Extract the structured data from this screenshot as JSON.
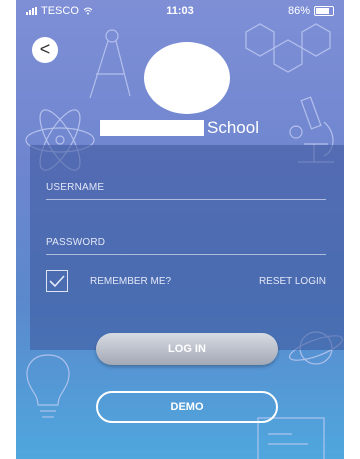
{
  "status_bar": {
    "carrier": "TESCO",
    "time": "11:03",
    "battery": "86%"
  },
  "header": {
    "back_symbol": "<",
    "school_name": "School"
  },
  "form": {
    "username_label": "USERNAME",
    "password_label": "PASSWORD",
    "remember_label": "REMEMBER ME?",
    "remember_checked": true,
    "reset_label": "RESET LOGIN"
  },
  "buttons": {
    "login_label": "LOG IN",
    "demo_label": "DEMO"
  },
  "colors": {
    "background_top": "#7e8fd6",
    "background_bottom": "#4fa7de",
    "panel": "#3c559b",
    "login_button": "#b9bdc8",
    "text": "#ffffff"
  },
  "icons": [
    "wifi-icon",
    "battery-icon",
    "back-arrow-icon",
    "compass-icon",
    "molecule-icon",
    "atom-icon",
    "microscope-icon",
    "lightbulb-icon",
    "planet-icon",
    "formula-book-icon",
    "checkmark-icon"
  ]
}
